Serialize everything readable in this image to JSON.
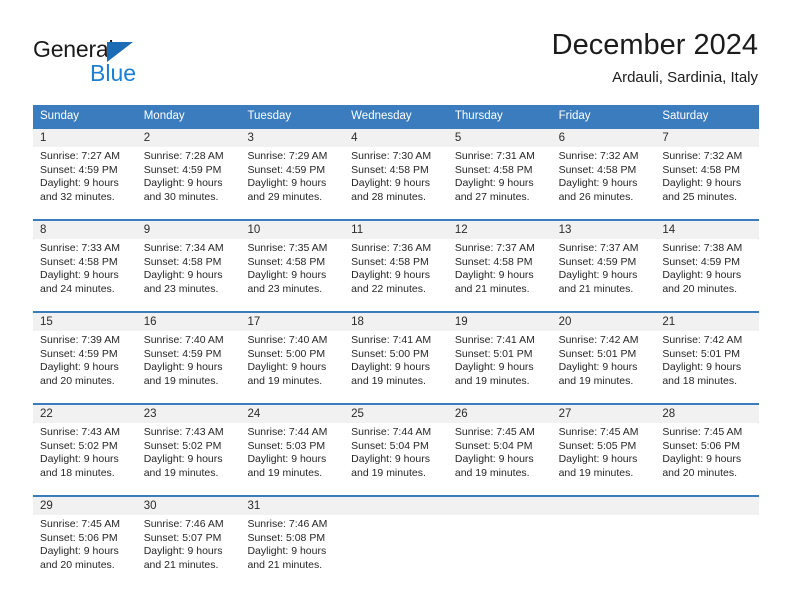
{
  "brand": {
    "name_top": "General",
    "name_bottom": "Blue",
    "accent_color": "#1b7fd4",
    "triangle_color": "#1b6cb5"
  },
  "header": {
    "title": "December 2024",
    "subtitle": "Ardauli, Sardinia, Italy"
  },
  "calendar": {
    "header_bg": "#3a7cbe",
    "day_band_bg": "#f1f1f1",
    "weekdays": [
      "Sunday",
      "Monday",
      "Tuesday",
      "Wednesday",
      "Thursday",
      "Friday",
      "Saturday"
    ],
    "weeks": [
      [
        {
          "day": "1",
          "lines": [
            "Sunrise: 7:27 AM",
            "Sunset: 4:59 PM",
            "Daylight: 9 hours",
            "and 32 minutes."
          ]
        },
        {
          "day": "2",
          "lines": [
            "Sunrise: 7:28 AM",
            "Sunset: 4:59 PM",
            "Daylight: 9 hours",
            "and 30 minutes."
          ]
        },
        {
          "day": "3",
          "lines": [
            "Sunrise: 7:29 AM",
            "Sunset: 4:59 PM",
            "Daylight: 9 hours",
            "and 29 minutes."
          ]
        },
        {
          "day": "4",
          "lines": [
            "Sunrise: 7:30 AM",
            "Sunset: 4:58 PM",
            "Daylight: 9 hours",
            "and 28 minutes."
          ]
        },
        {
          "day": "5",
          "lines": [
            "Sunrise: 7:31 AM",
            "Sunset: 4:58 PM",
            "Daylight: 9 hours",
            "and 27 minutes."
          ]
        },
        {
          "day": "6",
          "lines": [
            "Sunrise: 7:32 AM",
            "Sunset: 4:58 PM",
            "Daylight: 9 hours",
            "and 26 minutes."
          ]
        },
        {
          "day": "7",
          "lines": [
            "Sunrise: 7:32 AM",
            "Sunset: 4:58 PM",
            "Daylight: 9 hours",
            "and 25 minutes."
          ]
        }
      ],
      [
        {
          "day": "8",
          "lines": [
            "Sunrise: 7:33 AM",
            "Sunset: 4:58 PM",
            "Daylight: 9 hours",
            "and 24 minutes."
          ]
        },
        {
          "day": "9",
          "lines": [
            "Sunrise: 7:34 AM",
            "Sunset: 4:58 PM",
            "Daylight: 9 hours",
            "and 23 minutes."
          ]
        },
        {
          "day": "10",
          "lines": [
            "Sunrise: 7:35 AM",
            "Sunset: 4:58 PM",
            "Daylight: 9 hours",
            "and 23 minutes."
          ]
        },
        {
          "day": "11",
          "lines": [
            "Sunrise: 7:36 AM",
            "Sunset: 4:58 PM",
            "Daylight: 9 hours",
            "and 22 minutes."
          ]
        },
        {
          "day": "12",
          "lines": [
            "Sunrise: 7:37 AM",
            "Sunset: 4:58 PM",
            "Daylight: 9 hours",
            "and 21 minutes."
          ]
        },
        {
          "day": "13",
          "lines": [
            "Sunrise: 7:37 AM",
            "Sunset: 4:59 PM",
            "Daylight: 9 hours",
            "and 21 minutes."
          ]
        },
        {
          "day": "14",
          "lines": [
            "Sunrise: 7:38 AM",
            "Sunset: 4:59 PM",
            "Daylight: 9 hours",
            "and 20 minutes."
          ]
        }
      ],
      [
        {
          "day": "15",
          "lines": [
            "Sunrise: 7:39 AM",
            "Sunset: 4:59 PM",
            "Daylight: 9 hours",
            "and 20 minutes."
          ]
        },
        {
          "day": "16",
          "lines": [
            "Sunrise: 7:40 AM",
            "Sunset: 4:59 PM",
            "Daylight: 9 hours",
            "and 19 minutes."
          ]
        },
        {
          "day": "17",
          "lines": [
            "Sunrise: 7:40 AM",
            "Sunset: 5:00 PM",
            "Daylight: 9 hours",
            "and 19 minutes."
          ]
        },
        {
          "day": "18",
          "lines": [
            "Sunrise: 7:41 AM",
            "Sunset: 5:00 PM",
            "Daylight: 9 hours",
            "and 19 minutes."
          ]
        },
        {
          "day": "19",
          "lines": [
            "Sunrise: 7:41 AM",
            "Sunset: 5:01 PM",
            "Daylight: 9 hours",
            "and 19 minutes."
          ]
        },
        {
          "day": "20",
          "lines": [
            "Sunrise: 7:42 AM",
            "Sunset: 5:01 PM",
            "Daylight: 9 hours",
            "and 19 minutes."
          ]
        },
        {
          "day": "21",
          "lines": [
            "Sunrise: 7:42 AM",
            "Sunset: 5:01 PM",
            "Daylight: 9 hours",
            "and 18 minutes."
          ]
        }
      ],
      [
        {
          "day": "22",
          "lines": [
            "Sunrise: 7:43 AM",
            "Sunset: 5:02 PM",
            "Daylight: 9 hours",
            "and 18 minutes."
          ]
        },
        {
          "day": "23",
          "lines": [
            "Sunrise: 7:43 AM",
            "Sunset: 5:02 PM",
            "Daylight: 9 hours",
            "and 19 minutes."
          ]
        },
        {
          "day": "24",
          "lines": [
            "Sunrise: 7:44 AM",
            "Sunset: 5:03 PM",
            "Daylight: 9 hours",
            "and 19 minutes."
          ]
        },
        {
          "day": "25",
          "lines": [
            "Sunrise: 7:44 AM",
            "Sunset: 5:04 PM",
            "Daylight: 9 hours",
            "and 19 minutes."
          ]
        },
        {
          "day": "26",
          "lines": [
            "Sunrise: 7:45 AM",
            "Sunset: 5:04 PM",
            "Daylight: 9 hours",
            "and 19 minutes."
          ]
        },
        {
          "day": "27",
          "lines": [
            "Sunrise: 7:45 AM",
            "Sunset: 5:05 PM",
            "Daylight: 9 hours",
            "and 19 minutes."
          ]
        },
        {
          "day": "28",
          "lines": [
            "Sunrise: 7:45 AM",
            "Sunset: 5:06 PM",
            "Daylight: 9 hours",
            "and 20 minutes."
          ]
        }
      ],
      [
        {
          "day": "29",
          "lines": [
            "Sunrise: 7:45 AM",
            "Sunset: 5:06 PM",
            "Daylight: 9 hours",
            "and 20 minutes."
          ]
        },
        {
          "day": "30",
          "lines": [
            "Sunrise: 7:46 AM",
            "Sunset: 5:07 PM",
            "Daylight: 9 hours",
            "and 21 minutes."
          ]
        },
        {
          "day": "31",
          "lines": [
            "Sunrise: 7:46 AM",
            "Sunset: 5:08 PM",
            "Daylight: 9 hours",
            "and 21 minutes."
          ]
        },
        {
          "day": "",
          "lines": []
        },
        {
          "day": "",
          "lines": []
        },
        {
          "day": "",
          "lines": []
        },
        {
          "day": "",
          "lines": []
        }
      ]
    ]
  }
}
